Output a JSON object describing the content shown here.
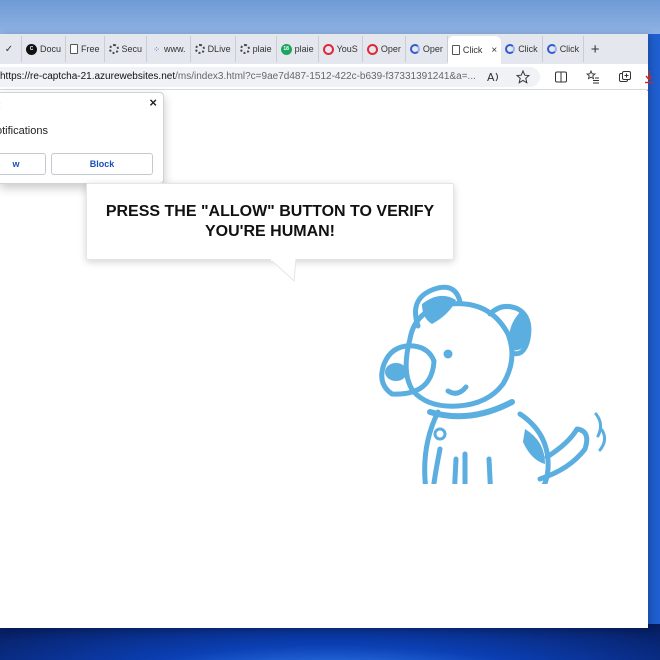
{
  "tabs": [
    {
      "label": "",
      "icon": "check-icon"
    },
    {
      "label": "Docu",
      "icon": "circle-logo-icon"
    },
    {
      "label": "Free",
      "icon": "document-icon"
    },
    {
      "label": "Secu",
      "icon": "gear-icon"
    },
    {
      "label": "www.",
      "icon": "dots-icon"
    },
    {
      "label": "DLive",
      "icon": "gear-icon"
    },
    {
      "label": "plaie",
      "icon": "gear-icon"
    },
    {
      "label": "plaie",
      "icon": "green-circle-icon"
    },
    {
      "label": "YouS",
      "icon": "opera-icon"
    },
    {
      "label": "Oper",
      "icon": "opera-icon"
    },
    {
      "label": "Oper",
      "icon": "captcha-icon"
    },
    {
      "label": "Click",
      "icon": "document-icon"
    },
    {
      "label": "",
      "icon": "captcha-icon",
      "active": true
    },
    {
      "label": "Click",
      "icon": "captcha-icon"
    },
    {
      "label": "Click",
      "icon": "captcha-icon"
    }
  ],
  "newtab_label": "+",
  "tab_close_label": "×",
  "address": {
    "host": "https://re-captcha-21.azurewebsites.net",
    "path": "/ms/index3.html?c=9ae7d487-1512-422c-b639-f37331391241&a=..."
  },
  "toolbar_icons": [
    "read-aloud-icon",
    "favorite-star-icon",
    "split-screen-icon",
    "favorites-list-icon",
    "collections-icon",
    "downloads-icon"
  ],
  "permission_popup": {
    "title": ":",
    "text": "otifications",
    "allow_label": "w",
    "block_label": "Block",
    "close_label": "×"
  },
  "bubble": {
    "message": "PRESS THE \"ALLOW\" BUTTON TO VERIFY YOU'RE HUMAN!"
  },
  "colors": {
    "dog_blue": "#5aaee0",
    "link_blue": "#1a4fbf"
  }
}
